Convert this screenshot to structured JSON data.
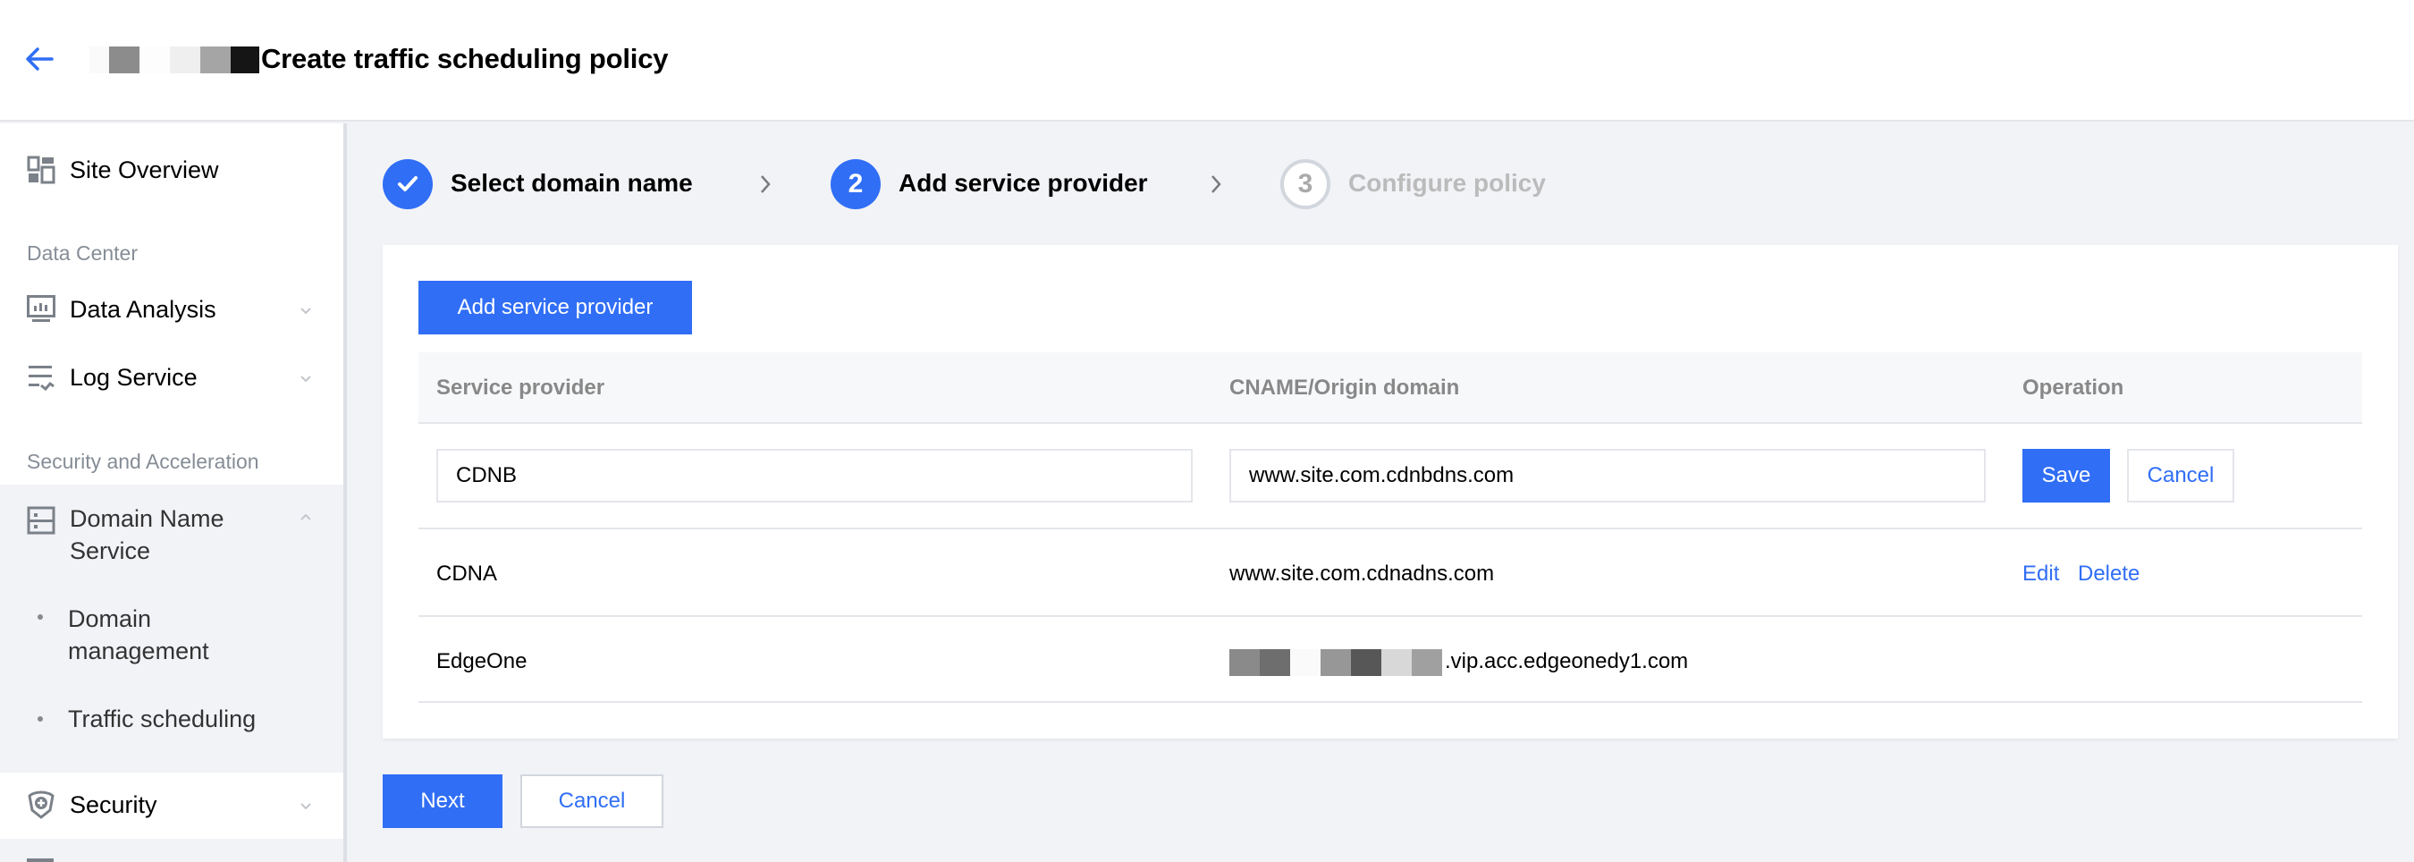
{
  "header": {
    "back_icon": "arrow-left-icon",
    "title": "Create traffic scheduling policy",
    "redacted": true
  },
  "sidebar": {
    "items": [
      {
        "label": "Site Overview",
        "icon": "dashboard-icon"
      },
      {
        "label": "Data Analysis",
        "icon": "monitor-chart-icon",
        "expandable": true,
        "expanded": false
      },
      {
        "label": "Log Service",
        "icon": "log-list-icon",
        "expandable": true,
        "expanded": false
      },
      {
        "label": "Domain Name Service",
        "icon": "server-icon",
        "expandable": true,
        "expanded": true
      },
      {
        "label": "Security",
        "icon": "shield-plus-icon",
        "expandable": true,
        "expanded": false
      }
    ],
    "groups": {
      "data_center": "Data Center",
      "security_acceleration": "Security and Acceleration"
    },
    "dns_subitems": [
      {
        "label": "Domain management"
      },
      {
        "label": "Traffic scheduling",
        "active": true
      }
    ]
  },
  "steps": [
    {
      "index": "1",
      "label": "Select domain name",
      "status": "done"
    },
    {
      "index": "2",
      "label": "Add service provider",
      "status": "current"
    },
    {
      "index": "3",
      "label": "Configure policy",
      "status": "pending"
    }
  ],
  "card": {
    "add_button": "Add service provider",
    "table": {
      "columns": [
        "Service provider",
        "CNAME/Origin domain",
        "Operation"
      ],
      "editing_row": {
        "provider_value": "CDNB",
        "domain_value": "www.site.com.cdnbdns.com",
        "save_label": "Save",
        "cancel_label": "Cancel"
      },
      "rows": [
        {
          "provider": "CDNA",
          "domain": "www.site.com.cdnadns.com",
          "actions": [
            "Edit",
            "Delete"
          ]
        },
        {
          "provider": "EdgeOne",
          "domain_visible_suffix": ".vip.acc.edgeonedy1.com",
          "domain_redacted": true,
          "actions": []
        }
      ]
    }
  },
  "footer": {
    "next_label": "Next",
    "cancel_label": "Cancel"
  },
  "colors": {
    "accent": "#306ef5",
    "page_bg": "#f2f3f7",
    "muted_text": "#888888",
    "pending_step": "#bbbbbb"
  }
}
